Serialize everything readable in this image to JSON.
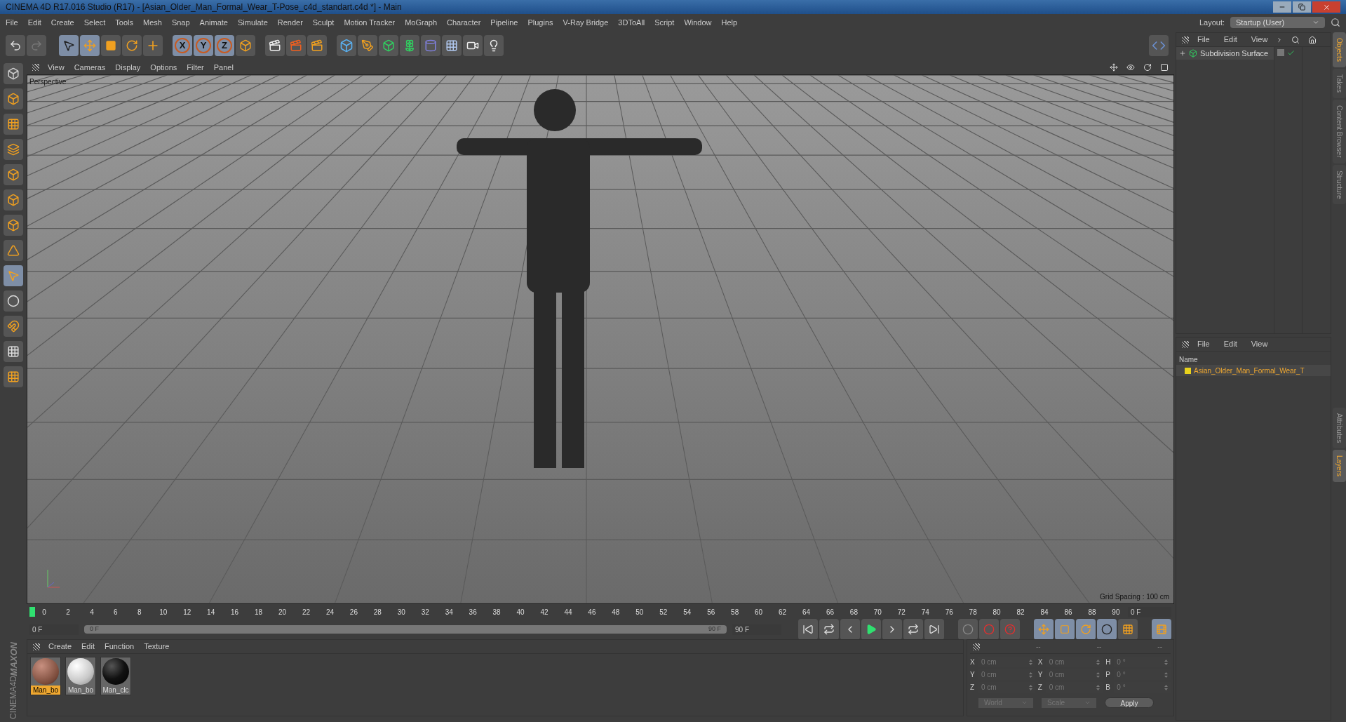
{
  "window": {
    "title": "CINEMA 4D R17.016 Studio (R17) - [Asian_Older_Man_Formal_Wear_T-Pose_c4d_standart.c4d *] - Main"
  },
  "menu": [
    "File",
    "Edit",
    "Create",
    "Select",
    "Tools",
    "Mesh",
    "Snap",
    "Animate",
    "Simulate",
    "Render",
    "Sculpt",
    "Motion Tracker",
    "MoGraph",
    "Character",
    "Pipeline",
    "Plugins",
    "V-Ray Bridge",
    "3DToAll",
    "Script",
    "Window",
    "Help"
  ],
  "layout": {
    "label": "Layout:",
    "value": "Startup (User)"
  },
  "toolbar_axes": [
    "X",
    "Y",
    "Z"
  ],
  "viewport": {
    "menu": [
      "View",
      "Cameras",
      "Display",
      "Options",
      "Filter",
      "Panel"
    ],
    "camera": "Perspective",
    "grid_spacing": "Grid Spacing : 100 cm"
  },
  "objects": {
    "menu": [
      "File",
      "Edit",
      "View"
    ],
    "items": [
      {
        "name": "Subdivision Surface"
      }
    ]
  },
  "side_tabs_top": [
    {
      "label": "Objects",
      "selected": true
    },
    {
      "label": "Takes",
      "selected": false
    },
    {
      "label": "Content Browser",
      "selected": false
    },
    {
      "label": "Structure",
      "selected": false
    }
  ],
  "layers": {
    "menu": [
      "File",
      "Edit",
      "View"
    ],
    "column": "Name",
    "items": [
      {
        "name": "Asian_Older_Man_Formal_Wear_T"
      }
    ]
  },
  "side_tabs_bottom": [
    {
      "label": "Attributes",
      "selected": false
    },
    {
      "label": "Layers",
      "selected": true
    }
  ],
  "timeline": {
    "ticks": [
      "0",
      "2",
      "4",
      "6",
      "8",
      "10",
      "12",
      "14",
      "16",
      "18",
      "20",
      "22",
      "24",
      "26",
      "28",
      "30",
      "32",
      "34",
      "36",
      "38",
      "40",
      "42",
      "44",
      "46",
      "48",
      "50",
      "52",
      "54",
      "56",
      "58",
      "60",
      "62",
      "64",
      "66",
      "68",
      "70",
      "72",
      "74",
      "76",
      "78",
      "80",
      "82",
      "84",
      "86",
      "88",
      "90"
    ],
    "current_frame": "0 F",
    "level": 0,
    "start": "0 F",
    "range": {
      "start": "0 F",
      "end": "90 F",
      "level": 1
    },
    "end": "90 F"
  },
  "materials": {
    "menu": [
      "Create",
      "Edit",
      "Function",
      "Texture"
    ],
    "items": [
      {
        "name": "Man_bo",
        "kind": "skin",
        "selected": true
      },
      {
        "name": "Man_bo",
        "kind": "glass",
        "selected": false
      },
      {
        "name": "Man_clc",
        "kind": "black",
        "selected": false
      }
    ]
  },
  "coordinates": {
    "headers": [
      "--",
      "--",
      "--"
    ],
    "rows": [
      {
        "labels": [
          "X",
          "X",
          "H"
        ],
        "values": [
          "0 cm",
          "0 cm",
          "0 °"
        ]
      },
      {
        "labels": [
          "Y",
          "Y",
          "P"
        ],
        "values": [
          "0 cm",
          "0 cm",
          "0 °"
        ]
      },
      {
        "labels": [
          "Z",
          "Z",
          "B"
        ],
        "values": [
          "0 cm",
          "0 cm",
          "0 °"
        ]
      }
    ],
    "dropdowns": [
      "World",
      "Scale"
    ],
    "apply": "Apply"
  },
  "logo": [
    "MAXON",
    "CINEMA4D"
  ]
}
